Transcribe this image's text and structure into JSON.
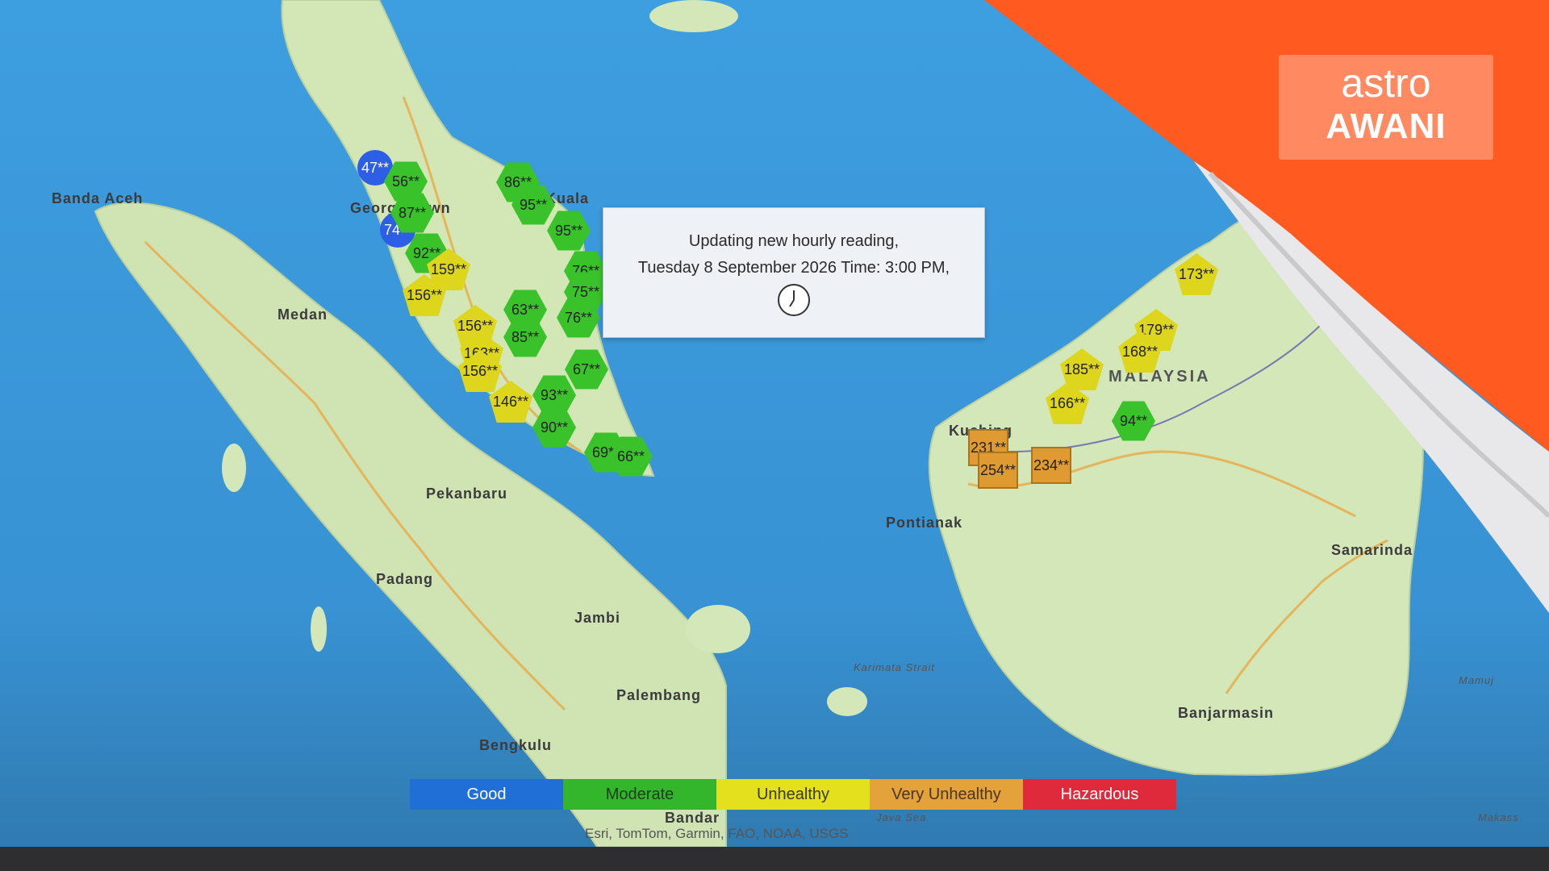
{
  "popup": {
    "line1": "Updating new hourly reading,",
    "line2": "Tuesday 8 September 2026 Time: 3:00 PM,",
    "icon": "clock-icon"
  },
  "legend": [
    {
      "label": "Good",
      "color": "#1f6fd6",
      "text_color": "#ffffff"
    },
    {
      "label": "Moderate",
      "color": "#33b52c",
      "text_color": "#1e3d1a"
    },
    {
      "label": "Unhealthy",
      "color": "#e5e01e",
      "text_color": "#3a3a10"
    },
    {
      "label": "Very Unhealthy",
      "color": "#e3a23a",
      "text_color": "#4a3618"
    },
    {
      "label": "Hazardous",
      "color": "#de2a3a",
      "text_color": "#ffffff"
    }
  ],
  "attribution": "Esri, TomTom, Garmin, FAO, NOAA, USGS",
  "logo": {
    "line1": "astro",
    "line2": "AWANI",
    "background": "#ff8a62",
    "banner_color": "#ff5a1f"
  },
  "places": {
    "banda_aceh": "Banda Aceh",
    "george_town": "George Town",
    "kuala": "Kuala",
    "medan": "Medan",
    "pekanbaru": "Pekanbaru",
    "padang": "Padang",
    "jambi": "Jambi",
    "palembang": "Palembang",
    "bengkulu": "Bengkulu",
    "bandar": "Bandar",
    "java_sea": "Java Sea",
    "karimata": "Karimata Strait",
    "pontianak": "Pontianak",
    "malaysia": "MALAYSIA",
    "samarinda": "Samarinda",
    "banjarmasin": "Banjarmasin",
    "kuching": "Kuching",
    "makassar": "Makass",
    "mamuju": "Mamuj"
  },
  "readings": [
    {
      "value": "47**",
      "category": "good",
      "shape": "circ"
    },
    {
      "value": "74**",
      "category": "good",
      "shape": "circ"
    },
    {
      "value": "56**",
      "category": "moderate",
      "shape": "hex"
    },
    {
      "value": "87**",
      "category": "moderate",
      "shape": "hex"
    },
    {
      "value": "92**",
      "category": "moderate",
      "shape": "hex"
    },
    {
      "value": "86**",
      "category": "moderate",
      "shape": "hex"
    },
    {
      "value": "95**",
      "category": "moderate",
      "shape": "hex"
    },
    {
      "value": "95**",
      "category": "moderate",
      "shape": "hex"
    },
    {
      "value": "76**",
      "category": "moderate",
      "shape": "hex"
    },
    {
      "value": "75**",
      "category": "moderate",
      "shape": "hex"
    },
    {
      "value": "76**",
      "category": "moderate",
      "shape": "hex"
    },
    {
      "value": "63**",
      "category": "moderate",
      "shape": "hex"
    },
    {
      "value": "85**",
      "category": "moderate",
      "shape": "hex"
    },
    {
      "value": "67**",
      "category": "moderate",
      "shape": "hex"
    },
    {
      "value": "93**",
      "category": "moderate",
      "shape": "hex"
    },
    {
      "value": "90**",
      "category": "moderate",
      "shape": "hex"
    },
    {
      "value": "69**",
      "category": "moderate",
      "shape": "hex"
    },
    {
      "value": "66**",
      "category": "moderate",
      "shape": "hex"
    },
    {
      "value": "94**",
      "category": "moderate",
      "shape": "hex"
    },
    {
      "value": "159**",
      "category": "unhealthy",
      "shape": "pent"
    },
    {
      "value": "156**",
      "category": "unhealthy",
      "shape": "pent"
    },
    {
      "value": "156**",
      "category": "unhealthy",
      "shape": "pent"
    },
    {
      "value": "163**",
      "category": "unhealthy",
      "shape": "pent"
    },
    {
      "value": "156**",
      "category": "unhealthy",
      "shape": "pent"
    },
    {
      "value": "146**",
      "category": "unhealthy",
      "shape": "pent"
    },
    {
      "value": "173**",
      "category": "unhealthy",
      "shape": "pent"
    },
    {
      "value": "179**",
      "category": "unhealthy",
      "shape": "pent"
    },
    {
      "value": "168**",
      "category": "unhealthy",
      "shape": "pent"
    },
    {
      "value": "185**",
      "category": "unhealthy",
      "shape": "pent"
    },
    {
      "value": "166**",
      "category": "unhealthy",
      "shape": "pent"
    },
    {
      "value": "231**",
      "category": "very-unhealthy",
      "shape": "sq"
    },
    {
      "value": "254**",
      "category": "very-unhealthy",
      "shape": "sq"
    },
    {
      "value": "234**",
      "category": "very-unhealthy",
      "shape": "sq"
    }
  ]
}
